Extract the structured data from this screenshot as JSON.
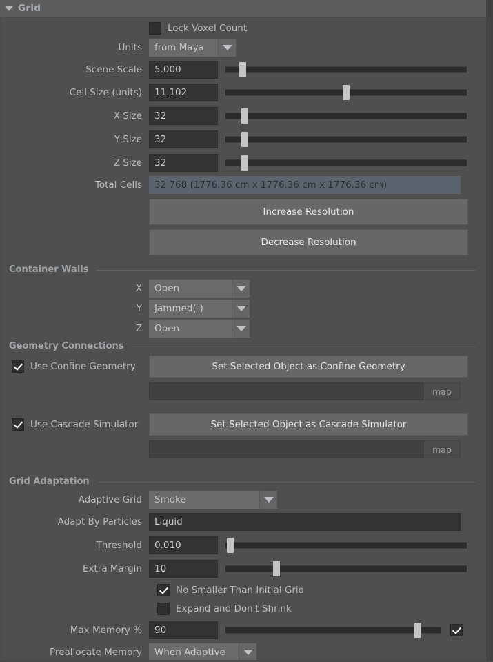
{
  "panel": {
    "title": "Grid",
    "collapse_icon": "triangle-down-icon"
  },
  "lock_voxel": {
    "label": "Lock Voxel Count",
    "checked": false
  },
  "units": {
    "label": "Units",
    "value": "from Maya"
  },
  "scene_scale": {
    "label": "Scene Scale",
    "value": "5.000",
    "slider_pct": 7
  },
  "cell_size": {
    "label": "Cell Size (units)",
    "value": "11.102",
    "slider_pct": 50
  },
  "x_size": {
    "label": "X Size",
    "value": "32",
    "slider_pct": 8
  },
  "y_size": {
    "label": "Y Size",
    "value": "32",
    "slider_pct": 8
  },
  "z_size": {
    "label": "Z Size",
    "value": "32",
    "slider_pct": 8
  },
  "total_cells": {
    "label": "Total Cells",
    "value": "32 768 (1776.36 cm x 1776.36 cm x 1776.36 cm)"
  },
  "increase_resolution": {
    "label": "Increase Resolution"
  },
  "decrease_resolution": {
    "label": "Decrease Resolution"
  },
  "container_walls": {
    "section_title": "Container Walls",
    "x": {
      "label": "X",
      "value": "Open"
    },
    "y": {
      "label": "Y",
      "value": "Jammed(-)"
    },
    "z": {
      "label": "Z",
      "value": "Open"
    }
  },
  "geometry_connections": {
    "section_title": "Geometry Connections",
    "use_confine": {
      "label": "Use Confine Geometry",
      "checked": true
    },
    "set_confine_button": "Set Selected Object as Confine Geometry",
    "confine_field": "",
    "confine_map_button": "map",
    "use_cascade": {
      "label": "Use Cascade Simulator",
      "checked": true
    },
    "set_cascade_button": "Set Selected Object as Cascade Simulator",
    "cascade_field": "",
    "cascade_map_button": "map"
  },
  "grid_adaptation": {
    "section_title": "Grid Adaptation",
    "adaptive_grid": {
      "label": "Adaptive Grid",
      "value": "Smoke"
    },
    "adapt_by_particles": {
      "label": "Adapt By Particles",
      "value": "Liquid"
    },
    "threshold": {
      "label": "Threshold",
      "value": "0.010",
      "slider_pct": 2
    },
    "extra_margin": {
      "label": "Extra Margin",
      "value": "10",
      "slider_pct": 21
    },
    "no_smaller": {
      "label": "No Smaller Than Initial Grid",
      "checked": true
    },
    "expand_no_shrink": {
      "label": "Expand and Don't Shrink",
      "checked": false
    },
    "max_memory": {
      "label": "Max Memory %",
      "value": "90",
      "slider_pct": 89,
      "toggle_checked": true
    },
    "preallocate_memory": {
      "label": "Preallocate Memory",
      "value": "When Adaptive"
    }
  },
  "colors": {
    "panel_bg": "#4f4f4f",
    "header_bg": "#5c5c5c",
    "field_bg": "#333333",
    "highlight_bg": "#5a646e",
    "button_bg": "#676767",
    "slider_track": "#2c2c2c",
    "slider_handle": "#c4c4c4",
    "text": "#b6bbbf"
  }
}
